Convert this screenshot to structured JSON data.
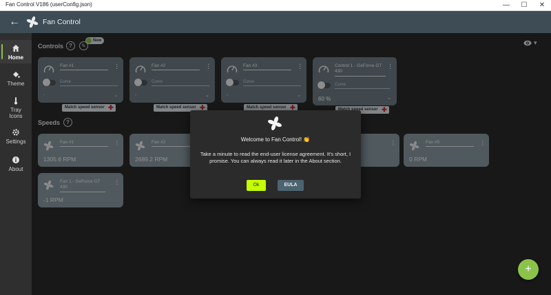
{
  "window": {
    "title": "Fan Control V186 (userConfig.json)",
    "minimize": "—",
    "maximize": "☐",
    "close": "✕"
  },
  "appbar": {
    "title": "Fan Control",
    "back_icon": "arrow-left-icon"
  },
  "sidebar": {
    "items": [
      {
        "label": "Home",
        "icon": "home-icon",
        "active": true
      },
      {
        "label": "Theme",
        "icon": "paint-bucket-icon"
      },
      {
        "label": "Tray Icons",
        "icon": "thermometer-icon"
      },
      {
        "label": "Settings",
        "icon": "gear-icon"
      },
      {
        "label": "About",
        "icon": "info-icon"
      }
    ]
  },
  "controls": {
    "heading": "Controls",
    "help": "?",
    "new_badge": "New",
    "cards": [
      {
        "name": "Fan #1",
        "curve": "Curve",
        "value": "-",
        "badge": "Match speed sensor"
      },
      {
        "name": "Fan #2",
        "curve": "Curve",
        "value": "-",
        "badge": "Match speed sensor"
      },
      {
        "name": "Fan #3",
        "curve": "Curve",
        "value": "-",
        "badge": "Match speed sensor"
      },
      {
        "name": "Control 1 - GeForce GT 430",
        "curve": "Curve",
        "value": "60 %",
        "badge": "Match speed sensor"
      }
    ]
  },
  "speeds": {
    "heading": "Speeds",
    "help": "?",
    "cards": [
      {
        "name": "Fan #1",
        "value": "1305.6 RPM"
      },
      {
        "name": "Fan #2",
        "value": "2689.2 RPM"
      },
      {
        "name": "Fan #5",
        "value": "0 RPM"
      },
      {
        "name": "Fan 1 - GeForce GT 430",
        "value": "-1 RPM"
      }
    ]
  },
  "dialog": {
    "title": "Welcome to Fan Control! 👏",
    "body": "Take a minute to read the end-user license agreement. It's short, I promise. You can always read it later in the About section.",
    "ok": "Ok",
    "eula": "EULA"
  },
  "fab": {
    "label": "+"
  },
  "colors": {
    "appbar": "#3d4c55",
    "card": "#8a9aa2",
    "accent": "#8bc34a",
    "ok_button": "#c6ff00",
    "eula_button": "#4c6470"
  }
}
